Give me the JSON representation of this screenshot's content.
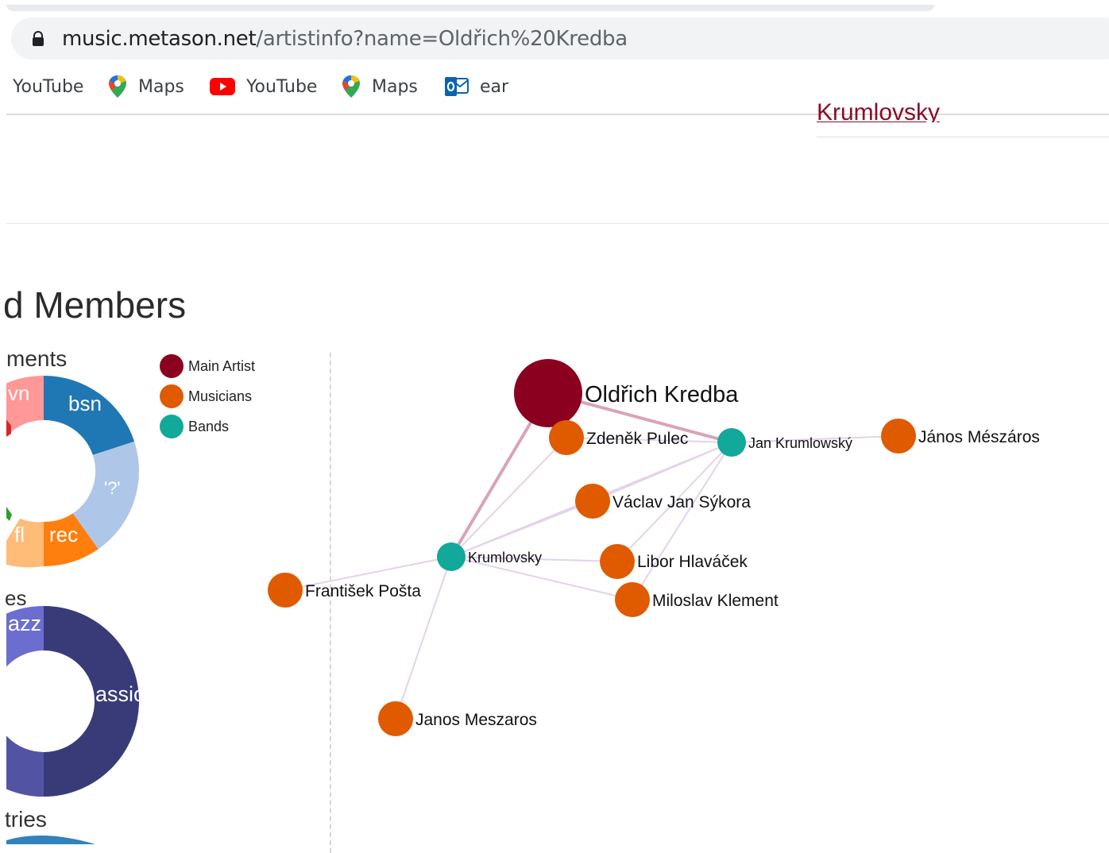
{
  "browser": {
    "url_host": "music.metason.net",
    "url_path": "/artistinfo?name=Oldřich%20Kredba",
    "bookmarks": [
      {
        "label": "YouTube",
        "icon": "none"
      },
      {
        "label": "Maps",
        "icon": "maps-pin-icon"
      },
      {
        "label": "YouTube",
        "icon": "youtube-icon"
      },
      {
        "label": "Maps",
        "icon": "maps-pin-icon"
      },
      {
        "label": "ear",
        "icon": "outlook-icon"
      }
    ]
  },
  "page": {
    "top_link": "Krumlovsky",
    "section_title": "d Members",
    "instruments_title": "ments",
    "genres_title": "es",
    "countries_title": "tries"
  },
  "legend": [
    {
      "label": "Main Artist",
      "color": "#8b001f"
    },
    {
      "label": "Musicians",
      "color": "#e05a00"
    },
    {
      "label": "Bands",
      "color": "#12a89a"
    }
  ],
  "instruments_chart": {
    "segment_labels": [
      "vn",
      "bsn",
      "'?'",
      "rec",
      "fl"
    ],
    "colors": [
      "#ff9896",
      "#1f77b4",
      "#aec7e8",
      "#ff7f0e",
      "#ffbb78"
    ]
  },
  "genres_chart": {
    "segment_labels": [
      "azz",
      "assic"
    ],
    "colors": [
      "#6b6ecf",
      "#393b79"
    ]
  },
  "network": {
    "nodes": [
      {
        "id": "kredba",
        "label": "Oldřich Kredba",
        "type": "main"
      },
      {
        "id": "pulec",
        "label": "Zdeněk Pulec",
        "type": "musician"
      },
      {
        "id": "jkrum",
        "label": "Jan Krumlowský",
        "type": "band"
      },
      {
        "id": "jmesz",
        "label": "János Mészáros",
        "type": "musician"
      },
      {
        "id": "sykora",
        "label": "Václav Jan Sýkora",
        "type": "musician"
      },
      {
        "id": "krum",
        "label": "Krumlovsky",
        "type": "band"
      },
      {
        "id": "hlavacek",
        "label": "Libor Hlaváček",
        "type": "musician"
      },
      {
        "id": "posta",
        "label": "František Pošta",
        "type": "musician"
      },
      {
        "id": "klement",
        "label": "Miloslav Klement",
        "type": "musician"
      },
      {
        "id": "jmesz2",
        "label": "Janos Meszaros",
        "type": "musician"
      }
    ],
    "links": [
      [
        "kredba",
        "jkrum"
      ],
      [
        "kredba",
        "krum"
      ],
      [
        "pulec",
        "jkrum"
      ],
      [
        "jkrum",
        "jmesz"
      ],
      [
        "jkrum",
        "sykora"
      ],
      [
        "jkrum",
        "hlavacek"
      ],
      [
        "jkrum",
        "klement"
      ],
      [
        "jkrum",
        "krum"
      ],
      [
        "krum",
        "pulec"
      ],
      [
        "krum",
        "sykora"
      ],
      [
        "krum",
        "hlavacek"
      ],
      [
        "krum",
        "klement"
      ],
      [
        "krum",
        "posta"
      ],
      [
        "krum",
        "jmesz2"
      ]
    ]
  }
}
